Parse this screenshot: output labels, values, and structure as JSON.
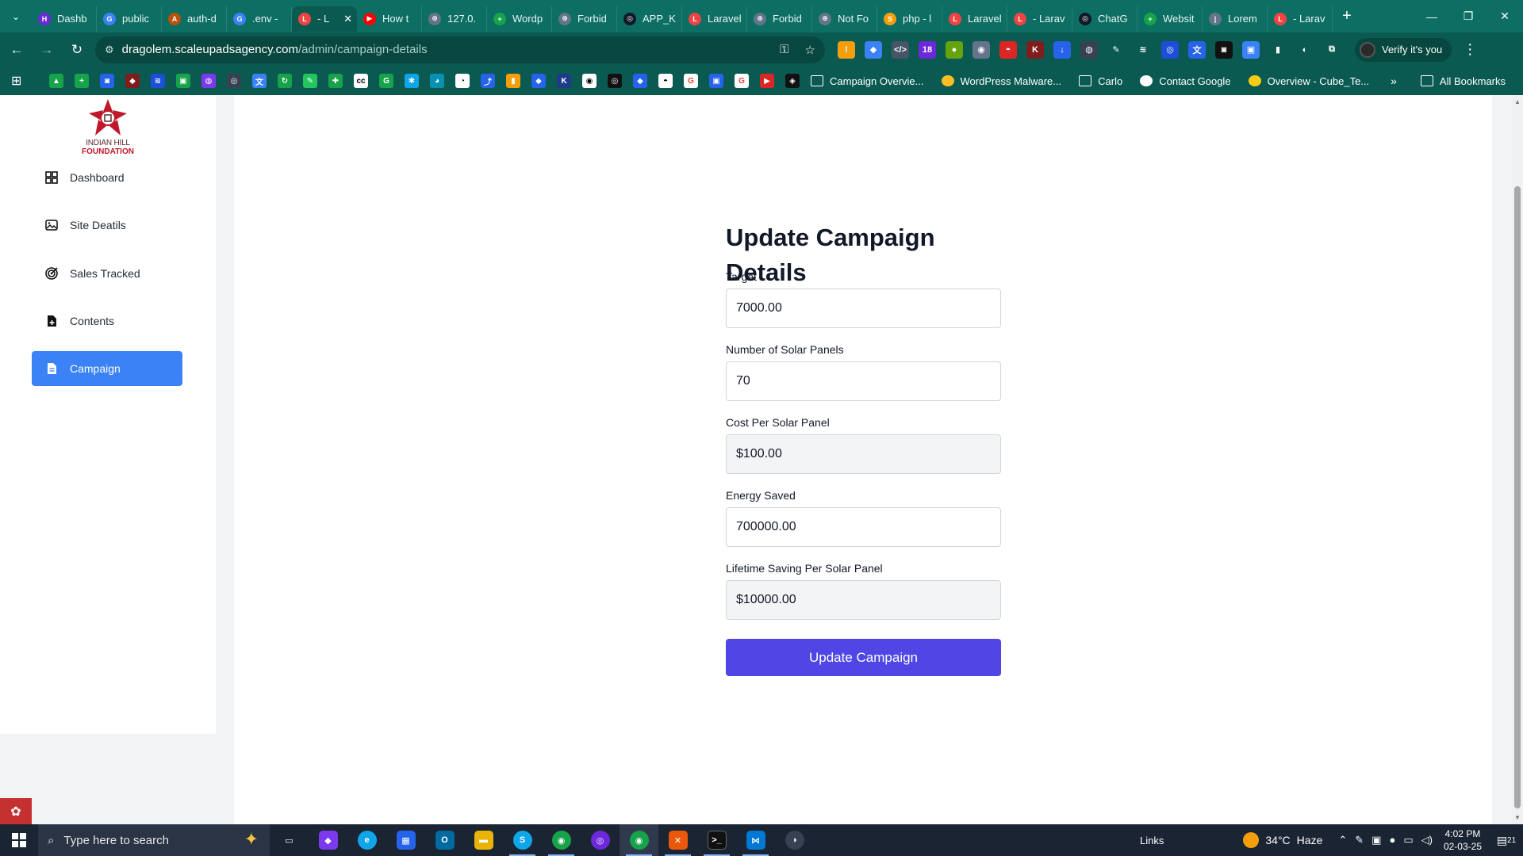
{
  "browser": {
    "tabs": [
      {
        "label": "Dashb",
        "fav_color": "#6d28d9",
        "fav_text": "H"
      },
      {
        "label": "public",
        "fav_color": "#3b82f6",
        "fav_text": "G"
      },
      {
        "label": "auth-d",
        "fav_color": "#b45309",
        "fav_text": "A"
      },
      {
        "label": ".env -",
        "fav_color": "#3b82f6",
        "fav_text": "G"
      },
      {
        "label": "- L",
        "fav_color": "#ef4444",
        "fav_text": "L",
        "active": true
      },
      {
        "label": "How t",
        "fav_color": "#ff0000",
        "fav_text": "▶"
      },
      {
        "label": "127.0.",
        "fav_color": "#64748b",
        "fav_text": "⊕"
      },
      {
        "label": "Wordp",
        "fav_color": "#16a34a",
        "fav_text": "+"
      },
      {
        "label": "Forbid",
        "fav_color": "#64748b",
        "fav_text": "⊕"
      },
      {
        "label": "APP_K",
        "fav_color": "#111827",
        "fav_text": "◎"
      },
      {
        "label": "Laravel",
        "fav_color": "#ef4444",
        "fav_text": "L"
      },
      {
        "label": "Forbid",
        "fav_color": "#64748b",
        "fav_text": "⊕"
      },
      {
        "label": "Not Fo",
        "fav_color": "#64748b",
        "fav_text": "⊕"
      },
      {
        "label": "php - l",
        "fav_color": "#f59e0b",
        "fav_text": "S"
      },
      {
        "label": "Laravel",
        "fav_color": "#ef4444",
        "fav_text": "L"
      },
      {
        "label": "- Larav",
        "fav_color": "#ef4444",
        "fav_text": "L"
      },
      {
        "label": "ChatG",
        "fav_color": "#111827",
        "fav_text": "◎"
      },
      {
        "label": "Websit",
        "fav_color": "#16a34a",
        "fav_text": "+"
      },
      {
        "label": "Lorem",
        "fav_color": "#64748b",
        "fav_text": "|"
      },
      {
        "label": "- Larav",
        "fav_color": "#ef4444",
        "fav_text": "L"
      }
    ],
    "url_host": "dragolem.scaleupadsagency.com",
    "url_path": "/admin/campaign-details",
    "profile_label": "Verify it's you",
    "bookmarks": [
      {
        "label": "Campaign Overvie..."
      },
      {
        "label": "WordPress Malware..."
      },
      {
        "label": "Carlo"
      },
      {
        "label": "Contact Google"
      },
      {
        "label": "Overview - Cube_Te..."
      }
    ],
    "all_bookmarks_label": "All Bookmarks",
    "colors": {
      "chrome": "#0d6e63",
      "chrome_dark": "#0a5a51"
    }
  },
  "sidebar": {
    "logo": {
      "line1": "INDIAN HILL",
      "line2": "FOUNDATION"
    },
    "items": [
      {
        "label": "Dashboard",
        "icon": "dashboard-icon"
      },
      {
        "label": "Site Deatils",
        "icon": "image-icon"
      },
      {
        "label": "Sales Tracked",
        "icon": "target-icon"
      },
      {
        "label": "Contents",
        "icon": "file-plus-icon"
      },
      {
        "label": "Campaign",
        "icon": "document-icon",
        "active": true
      }
    ],
    "active_color": "#3b82f6"
  },
  "form": {
    "title": "Update Campaign Details",
    "fields": [
      {
        "label": "Target",
        "value": "7000.00",
        "readonly": false
      },
      {
        "label": "Number of Solar Panels",
        "value": "70",
        "readonly": false
      },
      {
        "label": "Cost Per Solar Panel",
        "value": "$100.00",
        "readonly": true
      },
      {
        "label": "Energy Saved",
        "value": "700000.00",
        "readonly": false
      },
      {
        "label": "Lifetime Saving Per Solar Panel",
        "value": "$10000.00",
        "readonly": true
      }
    ],
    "submit_label": "Update Campaign",
    "submit_color": "#4f46e5"
  },
  "taskbar": {
    "search_placeholder": "Type here to search",
    "links_label": "Links",
    "temperature": "34°C",
    "weather": "Haze",
    "time": "4:02 PM",
    "date": "02-03-25",
    "notification_count": "21"
  }
}
